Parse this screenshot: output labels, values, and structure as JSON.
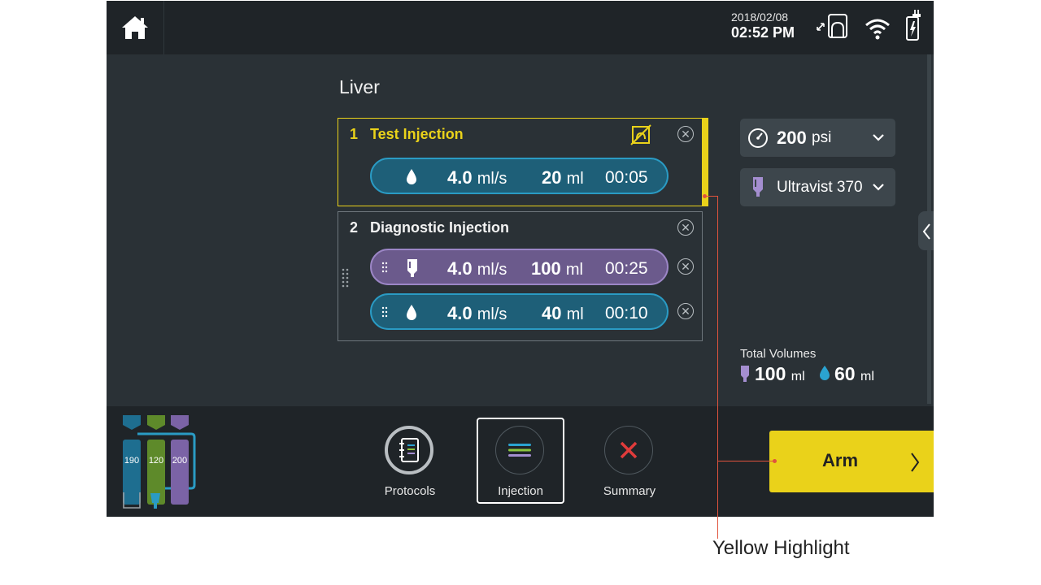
{
  "status": {
    "date": "2018/02/08",
    "time": "02:52 PM",
    "icons": [
      "home-icon",
      "injector-link-icon",
      "wifi-icon",
      "battery-charging-icon"
    ]
  },
  "protocol": {
    "title": "Liver",
    "phases": [
      {
        "number": "1",
        "name": "Test Injection",
        "highlight": "#ead21a",
        "icon": "no-scan-icon",
        "steps": [
          {
            "fluid": "saline",
            "icon": "saline-drop-icon",
            "rate": "4.0",
            "rate_unit": "ml/s",
            "volume": "20",
            "volume_unit": "ml",
            "duration": "00:05"
          }
        ]
      },
      {
        "number": "2",
        "name": "Diagnostic Injection",
        "steps": [
          {
            "fluid": "contrast",
            "icon": "contrast-bottle-icon",
            "rate": "4.0",
            "rate_unit": "ml/s",
            "volume": "100",
            "volume_unit": "ml",
            "duration": "00:25"
          },
          {
            "fluid": "saline",
            "icon": "saline-drop-icon",
            "rate": "4.0",
            "rate_unit": "ml/s",
            "volume": "40",
            "volume_unit": "ml",
            "duration": "00:10"
          }
        ]
      }
    ]
  },
  "settings": {
    "pressure_value": "200",
    "pressure_unit": "psi",
    "contrast_agent": "Ultravist 370"
  },
  "totals": {
    "label": "Total Volumes",
    "contrast_value": "100",
    "contrast_unit": "ml",
    "saline_value": "60",
    "saline_unit": "ml"
  },
  "syringes": {
    "values": [
      "190",
      "120",
      "200"
    ],
    "colors": [
      "#1e6e90",
      "#5e8a2a",
      "#7b63a6"
    ]
  },
  "nav": {
    "items": [
      {
        "label": "Protocols",
        "icon": "protocols-notebook-icon"
      },
      {
        "label": "Injection",
        "icon": "injection-lines-icon",
        "active": true
      },
      {
        "label": "Summary",
        "icon": "summary-x-icon"
      }
    ],
    "arm_label": "Arm"
  },
  "annotation": {
    "label": "Yellow Highlight"
  },
  "colors": {
    "highlight": "#ead21a",
    "saline": "#2a9bc4",
    "contrast": "#9c86c6",
    "callout": "#e0533d"
  }
}
